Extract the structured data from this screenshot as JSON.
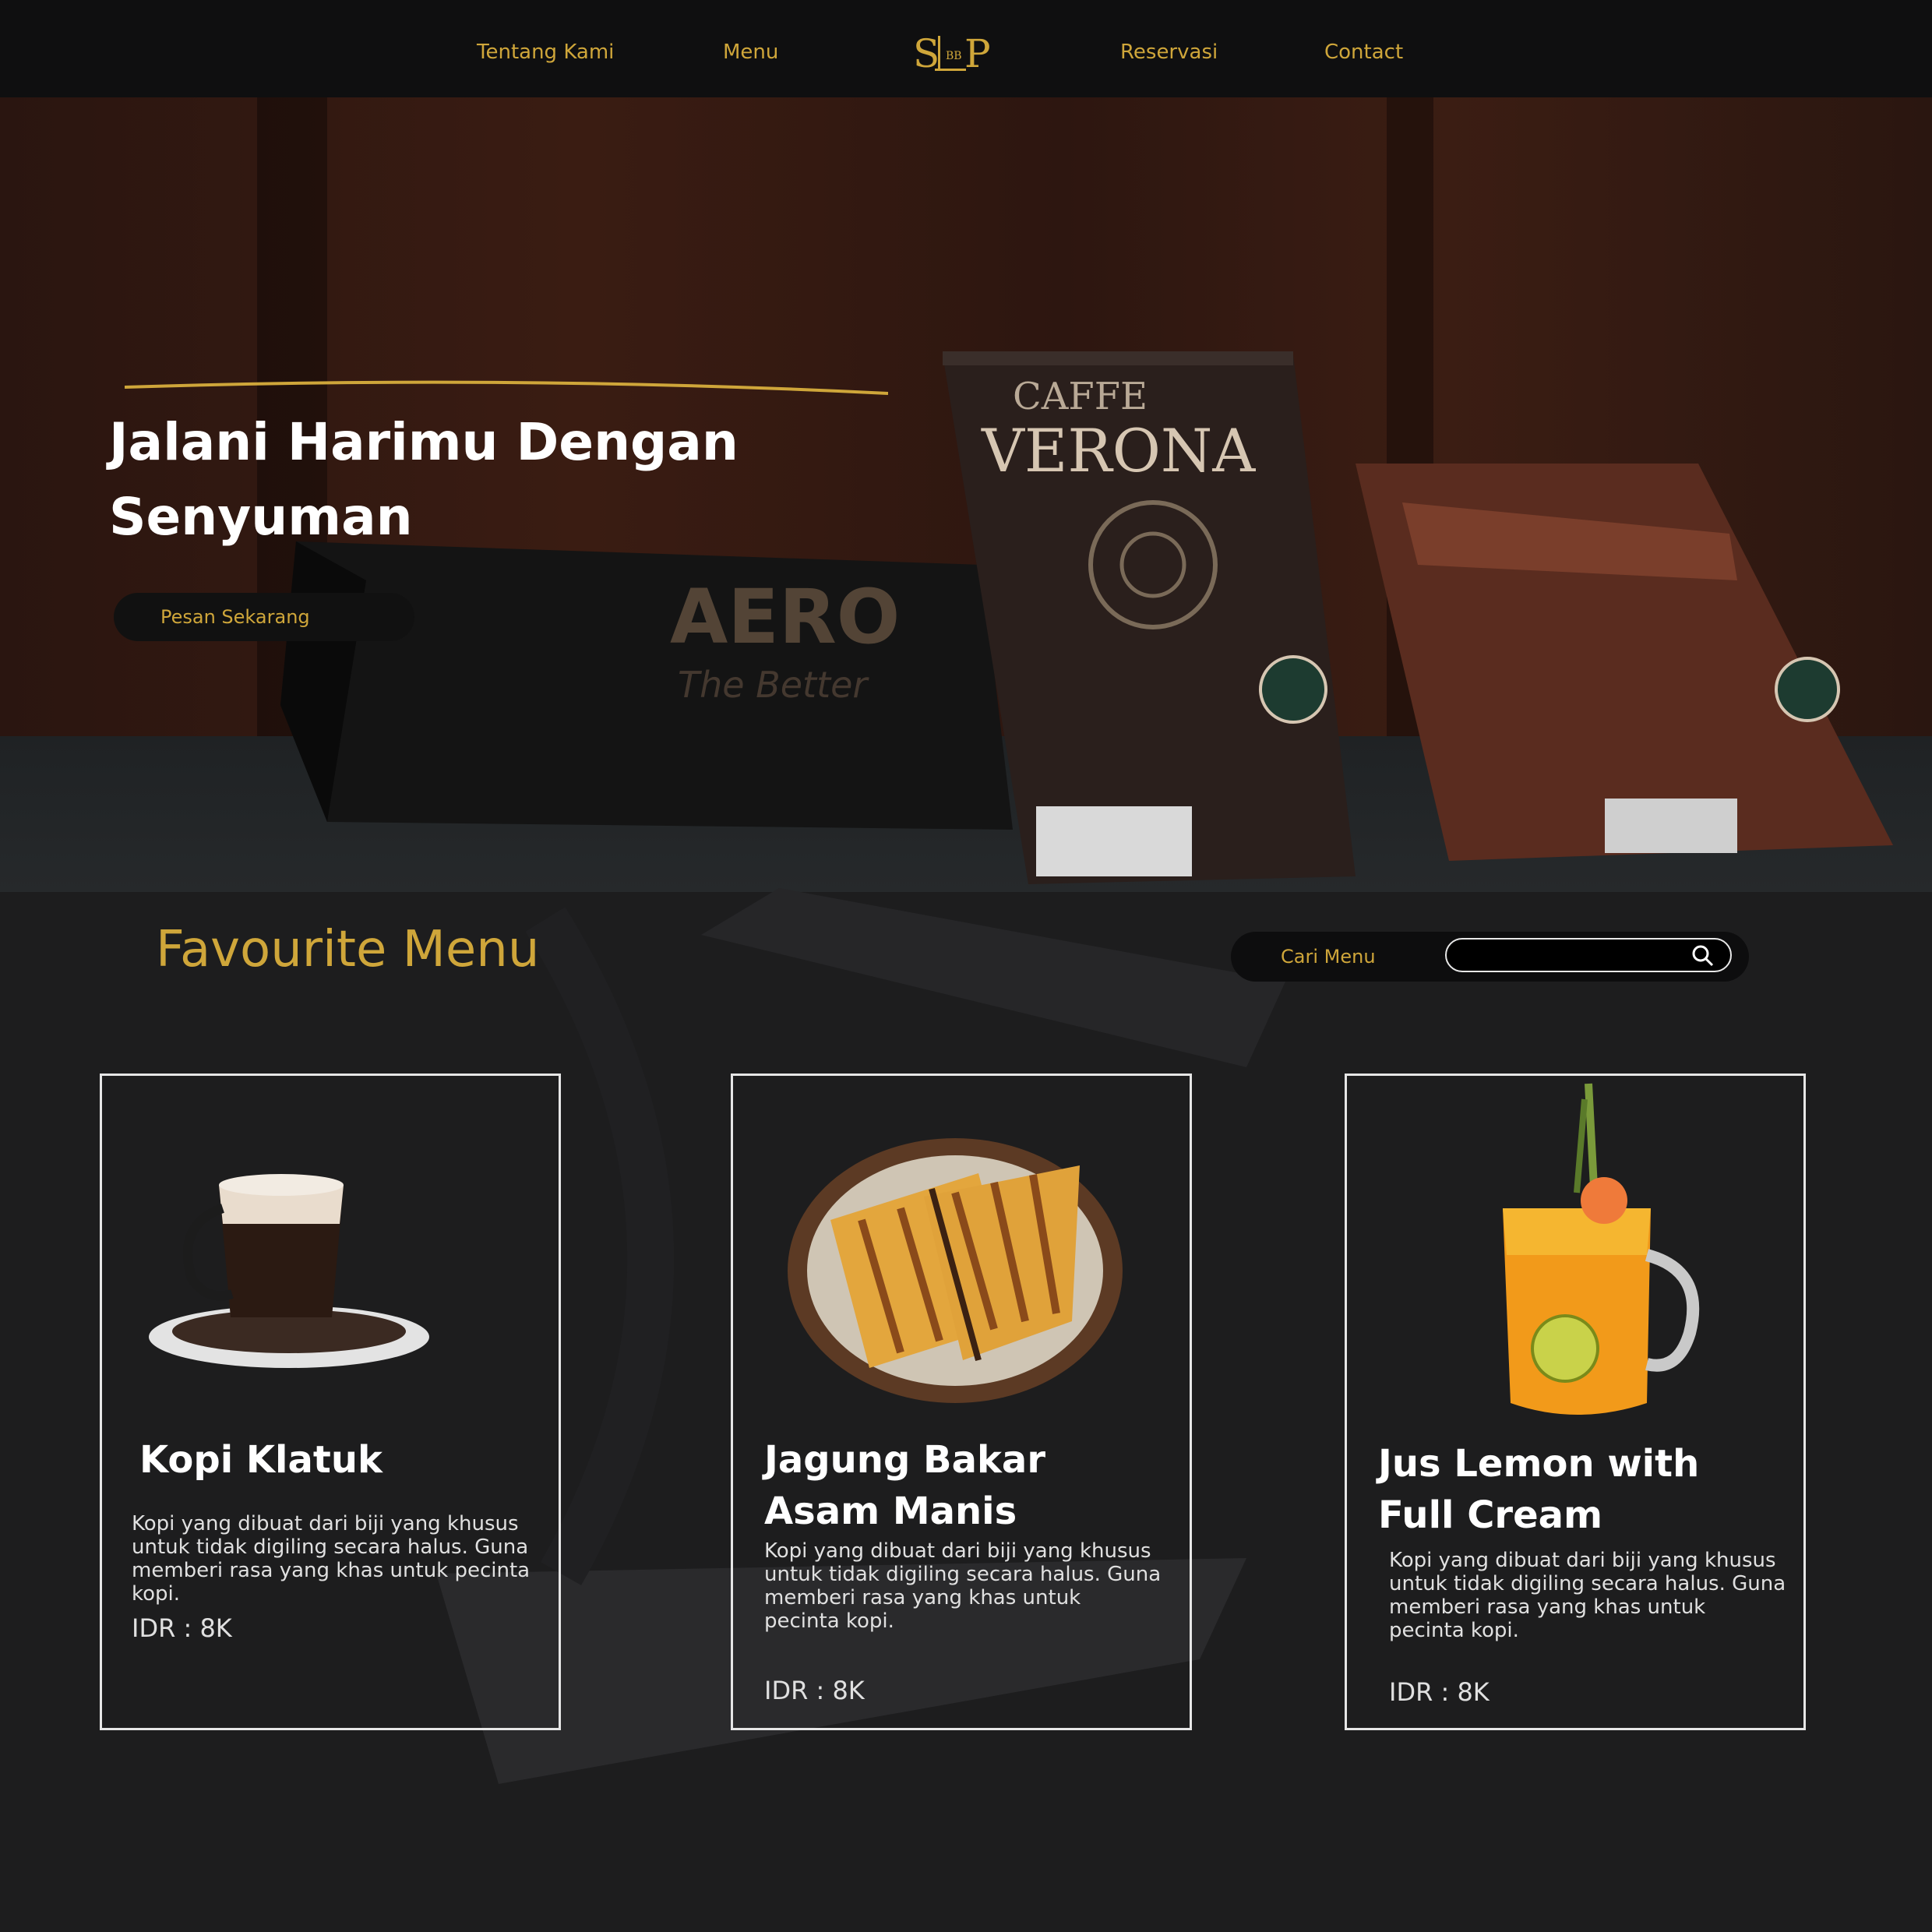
{
  "nav": {
    "links": [
      "Tentang Kami",
      "Menu",
      "Reservasi",
      "Contact"
    ],
    "logo_text": "SBP"
  },
  "hero": {
    "title": "Jalani Harimu Dengan Senyuman",
    "cta_label": "Pesan Sekarang"
  },
  "menu_section": {
    "title": "Favourite Menu",
    "search_label": "Cari Menu",
    "search_value": "",
    "items": [
      {
        "name": "Kopi Klatuk",
        "description": "Kopi yang dibuat dari biji yang khusus untuk tidak digiling secara halus. Guna memberi rasa yang khas untuk pecinta kopi.",
        "price": "IDR  : 8K",
        "image_icon": "coffee-cup-icon"
      },
      {
        "name": "Jagung Bakar Asam Manis",
        "description": "Kopi yang dibuat dari biji yang khusus untuk tidak digiling secara halus. Guna memberi rasa yang khas untuk pecinta kopi.",
        "price": "IDR  : 8K",
        "image_icon": "sandwich-plate-icon"
      },
      {
        "name": "Jus Lemon with Full Cream",
        "description": "Kopi yang dibuat dari biji yang khusus untuk tidak digiling secara halus. Guna memberi rasa yang khas untuk pecinta kopi.",
        "price": "IDR  : 8K",
        "image_icon": "juice-jar-icon"
      }
    ]
  },
  "colors": {
    "accent_gold": "#cfa63a",
    "background": "#1d1d1e",
    "topbar": "#0f0f10",
    "card_border": "#e6e6e6"
  }
}
